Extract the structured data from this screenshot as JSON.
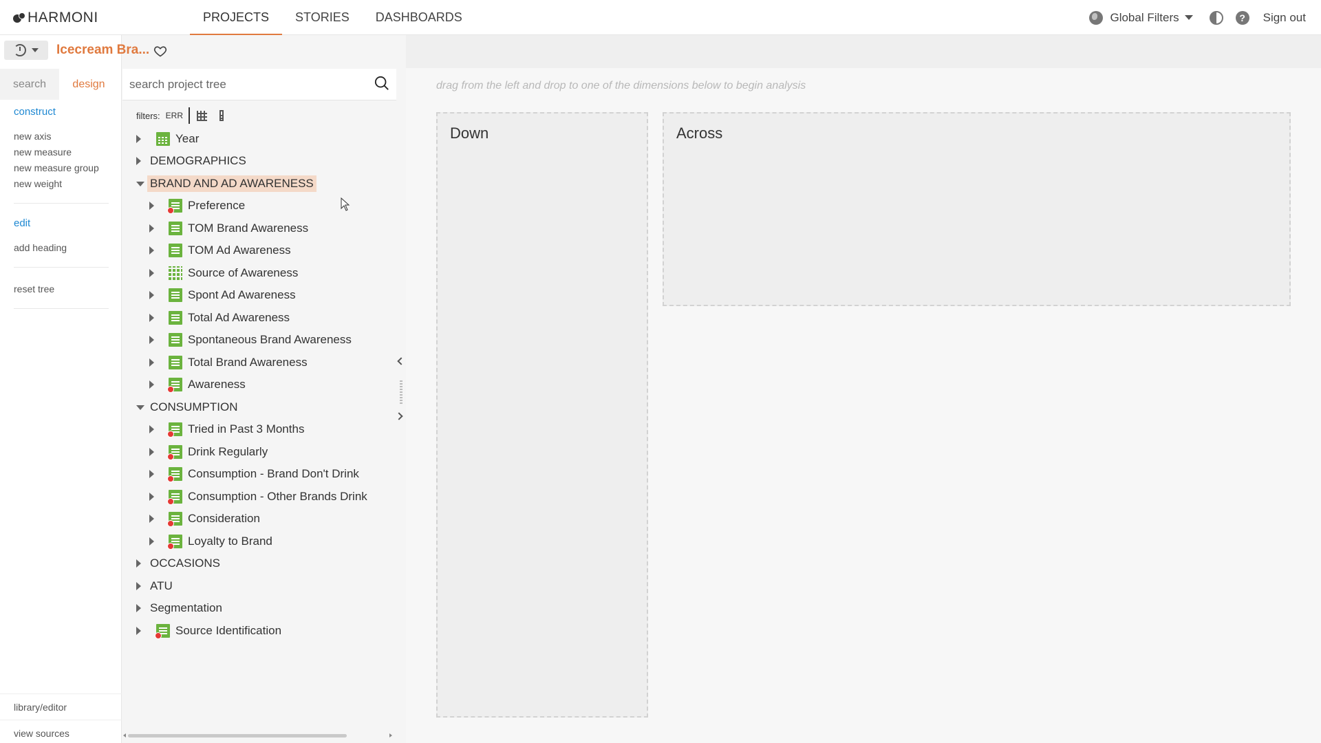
{
  "app": {
    "logo": "HARMONI"
  },
  "nav": {
    "tabs": [
      {
        "label": "PROJECTS"
      },
      {
        "label": "STORIES"
      },
      {
        "label": "DASHBOARDS"
      }
    ],
    "global_filters": "Global Filters",
    "sign_out": "Sign out",
    "help_glyph": "?"
  },
  "project": {
    "title": "Icecream Bra..."
  },
  "sidebar": {
    "tabs": [
      {
        "label": "search"
      },
      {
        "label": "design"
      }
    ],
    "construct_title": "construct",
    "construct_items": [
      "new axis",
      "new measure",
      "new measure group",
      "new weight"
    ],
    "edit_title": "edit",
    "edit_items": [
      "add heading"
    ],
    "reset": "reset tree",
    "bottom": [
      "library/editor",
      "view sources"
    ]
  },
  "tree": {
    "search_placeholder": "search project tree",
    "filters_label": "filters:",
    "filters_err": "ERR",
    "nodes": [
      "Year",
      "DEMOGRAPHICS",
      "BRAND AND AD AWARENESS",
      "Preference",
      "TOM Brand Awareness",
      "TOM Ad Awareness",
      "Source of Awareness",
      "Spont Ad Awareness",
      "Total Ad Awareness",
      "Spontaneous Brand Awareness",
      "Total Brand Awareness",
      "Awareness",
      "CONSUMPTION",
      "Tried in Past 3 Months",
      "Drink Regularly",
      "Consumption - Brand Don't Drink",
      "Consumption - Other Brands Drink",
      "Consideration",
      "Loyalty to Brand",
      "OCCASIONS",
      "ATU",
      "Segmentation",
      "Source Identification"
    ]
  },
  "analysis": {
    "hint": "drag from the left and drop to one of the dimensions below to begin analysis",
    "down": "Down",
    "across": "Across"
  },
  "colors": {
    "accent": "#e07a3f",
    "link": "#1e88d2",
    "measure_icon": "#6bb33e"
  }
}
